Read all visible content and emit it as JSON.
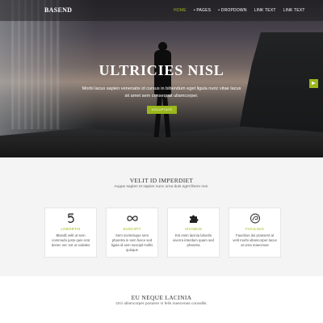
{
  "nav": {
    "brand": "BASEND",
    "items": [
      {
        "label": "HOME",
        "active": true
      },
      {
        "label": "• PAGES",
        "active": false
      },
      {
        "label": "• DROPDOWN",
        "active": false
      },
      {
        "label": "LINK TEXT",
        "active": false
      },
      {
        "label": "LINK TEXT",
        "active": false
      }
    ]
  },
  "hero": {
    "title": "ULTRICIES NISL",
    "text": "Morbi lacus sapien venenatis id cursus in bibendum eget ligula nunc vitae lacus sit amet sem consequat ullamcorper.",
    "button_label": "VOLUPTATE"
  },
  "features": {
    "title": "VELIT ID IMPERDIET",
    "subtitle": "Augue sapien et sapien nunc urna duis eget libero non.",
    "cards": [
      {
        "icon": "five-icon",
        "title": "LOBORTIS",
        "text": "Blandit velit ut sem commodo justo quis erat donec nec est ut sodales"
      },
      {
        "icon": "infinity-icon",
        "title": "SUSCIPIT",
        "text": "Sem scelerisque sem pharetra in sem fusce sed ligula id sem suscipit mollis quisque"
      },
      {
        "icon": "puzzle-icon",
        "title": "VIVAMUS",
        "text": "Est enim lacinia lobortis viverra interdum quam sed pharetra"
      },
      {
        "icon": "swirl-icon",
        "title": "FACILISIS",
        "text": "Faucibus dui praesent at velit morbi ullamcorper lacus at urna maecenas"
      }
    ]
  },
  "about": {
    "title": "EU NEQUE LACINIA",
    "subtitle": "Orci ullamcorper posuere in felis maecenas convallis."
  },
  "colors": {
    "accent": "#9ab71c"
  }
}
